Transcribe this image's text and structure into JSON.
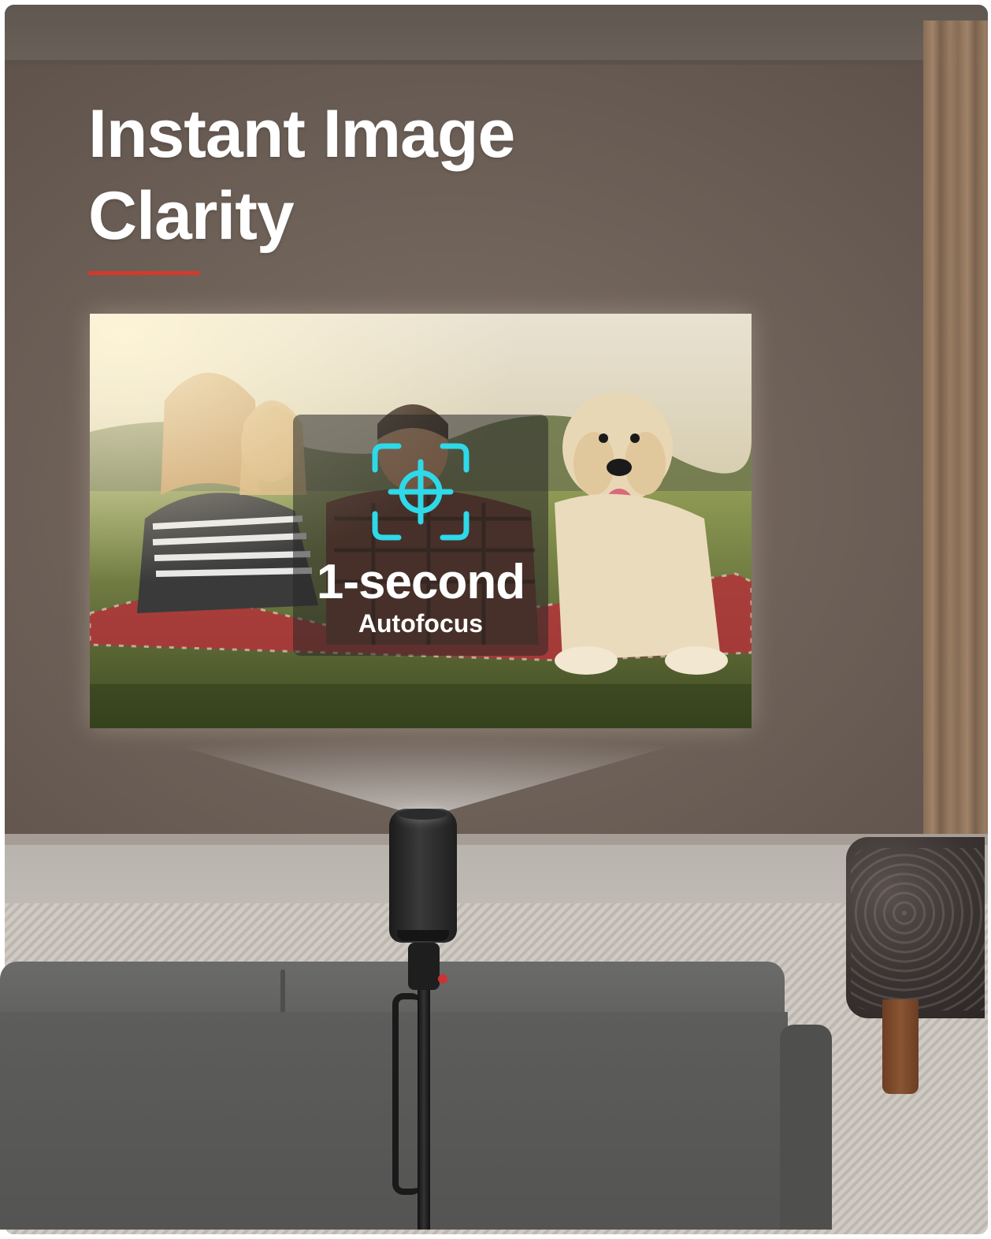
{
  "headline": {
    "title": "Instant Image\nClarity"
  },
  "feature": {
    "value": "1-second",
    "label": "Autofocus",
    "icon": "autofocus-target-icon",
    "icon_color": "#2ed9e8"
  },
  "colors": {
    "accent_line": "#d33a2c",
    "wall": "#6f6259"
  },
  "projected_scene": "family-with-dog-on-picnic-blanket-image"
}
